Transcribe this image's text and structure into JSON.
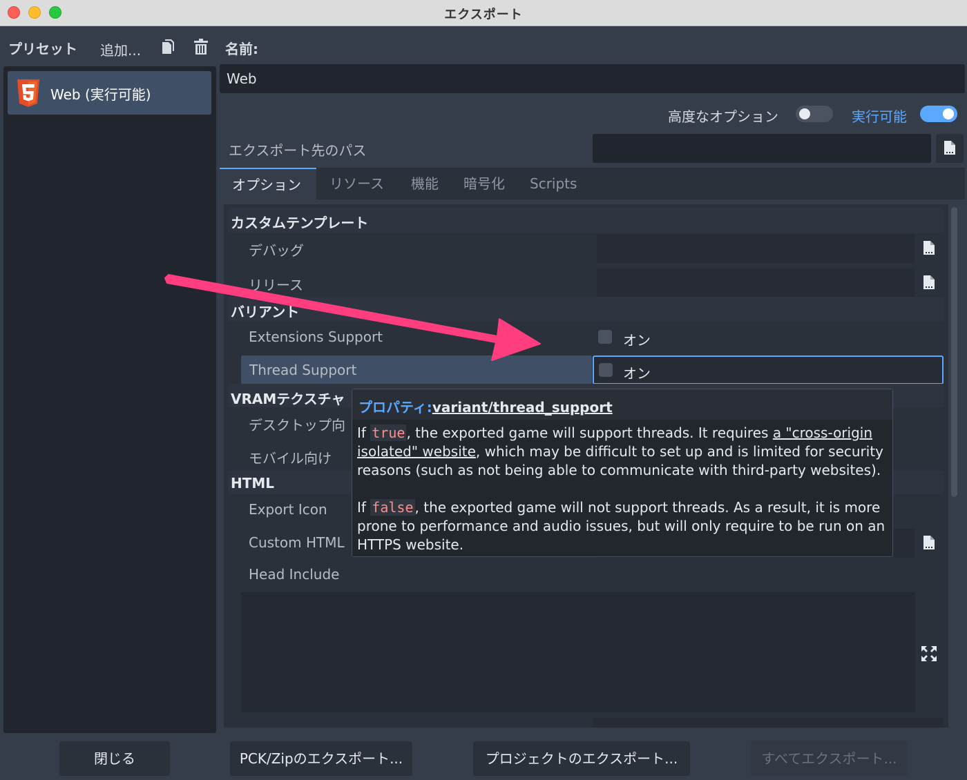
{
  "window": {
    "title": "エクスポート"
  },
  "toolbar": {
    "presets_label": "プリセット",
    "add_label": "追加...",
    "name_label": "名前:"
  },
  "presets": [
    {
      "label": "Web (実行可能)",
      "icon": "html5-icon"
    }
  ],
  "name_field": {
    "value": "Web"
  },
  "options": {
    "advanced_label": "高度なオプション",
    "advanced_on": false,
    "runnable_label": "実行可能",
    "runnable_on": true
  },
  "export_path": {
    "label": "エクスポート先のパス",
    "value": ""
  },
  "tabs": [
    {
      "label": "オプション",
      "active": true
    },
    {
      "label": "リソース",
      "active": false
    },
    {
      "label": "機能",
      "active": false
    },
    {
      "label": "暗号化",
      "active": false
    },
    {
      "label": "Scripts",
      "active": false
    }
  ],
  "inspector": {
    "custom_template": {
      "title": "カスタムテンプレート",
      "debug": "デバッグ",
      "release": "リリース"
    },
    "variant": {
      "title": "バリアント",
      "extensions_support": "Extensions Support",
      "extensions_value": "オン",
      "thread_support": "Thread Support",
      "thread_value": "オン"
    },
    "vram": {
      "title": "VRAMテクスチャ",
      "desktop": "デスクトップ向",
      "mobile": "モバイル向け"
    },
    "html": {
      "title": "HTML",
      "export_icon": "Export Icon",
      "custom_html": "Custom HTML",
      "head_include": "Head Include"
    }
  },
  "tooltip": {
    "title_prefix": "プロパティ:",
    "property_path": "variant/thread_support",
    "p1_if": "If ",
    "p1_code": "true",
    "p1_a": ", the exported game will support threads. It requires ",
    "p1_link": "a \"cross-origin isolated\" website",
    "p1_b": ", which may be difficult to set up and is limited for security reasons (such as not being able to communicate with third-party websites).",
    "p2_if": "If ",
    "p2_code": "false",
    "p2_a": ", the exported game will not support threads. As a result, it is more prone to performance and audio issues, but will only require to be run on an HTTPS website."
  },
  "buttons": {
    "close": "閉じる",
    "export_pck": "PCK/Zipのエクスポート...",
    "export_project": "プロジェクトのエクスポート...",
    "export_all": "すべてエクスポート..."
  },
  "colors": {
    "accent": "#5aa9ff",
    "annotation_arrow": "#ff3d7f",
    "panel_bg": "#21262e",
    "window_bg": "#363d4a"
  }
}
